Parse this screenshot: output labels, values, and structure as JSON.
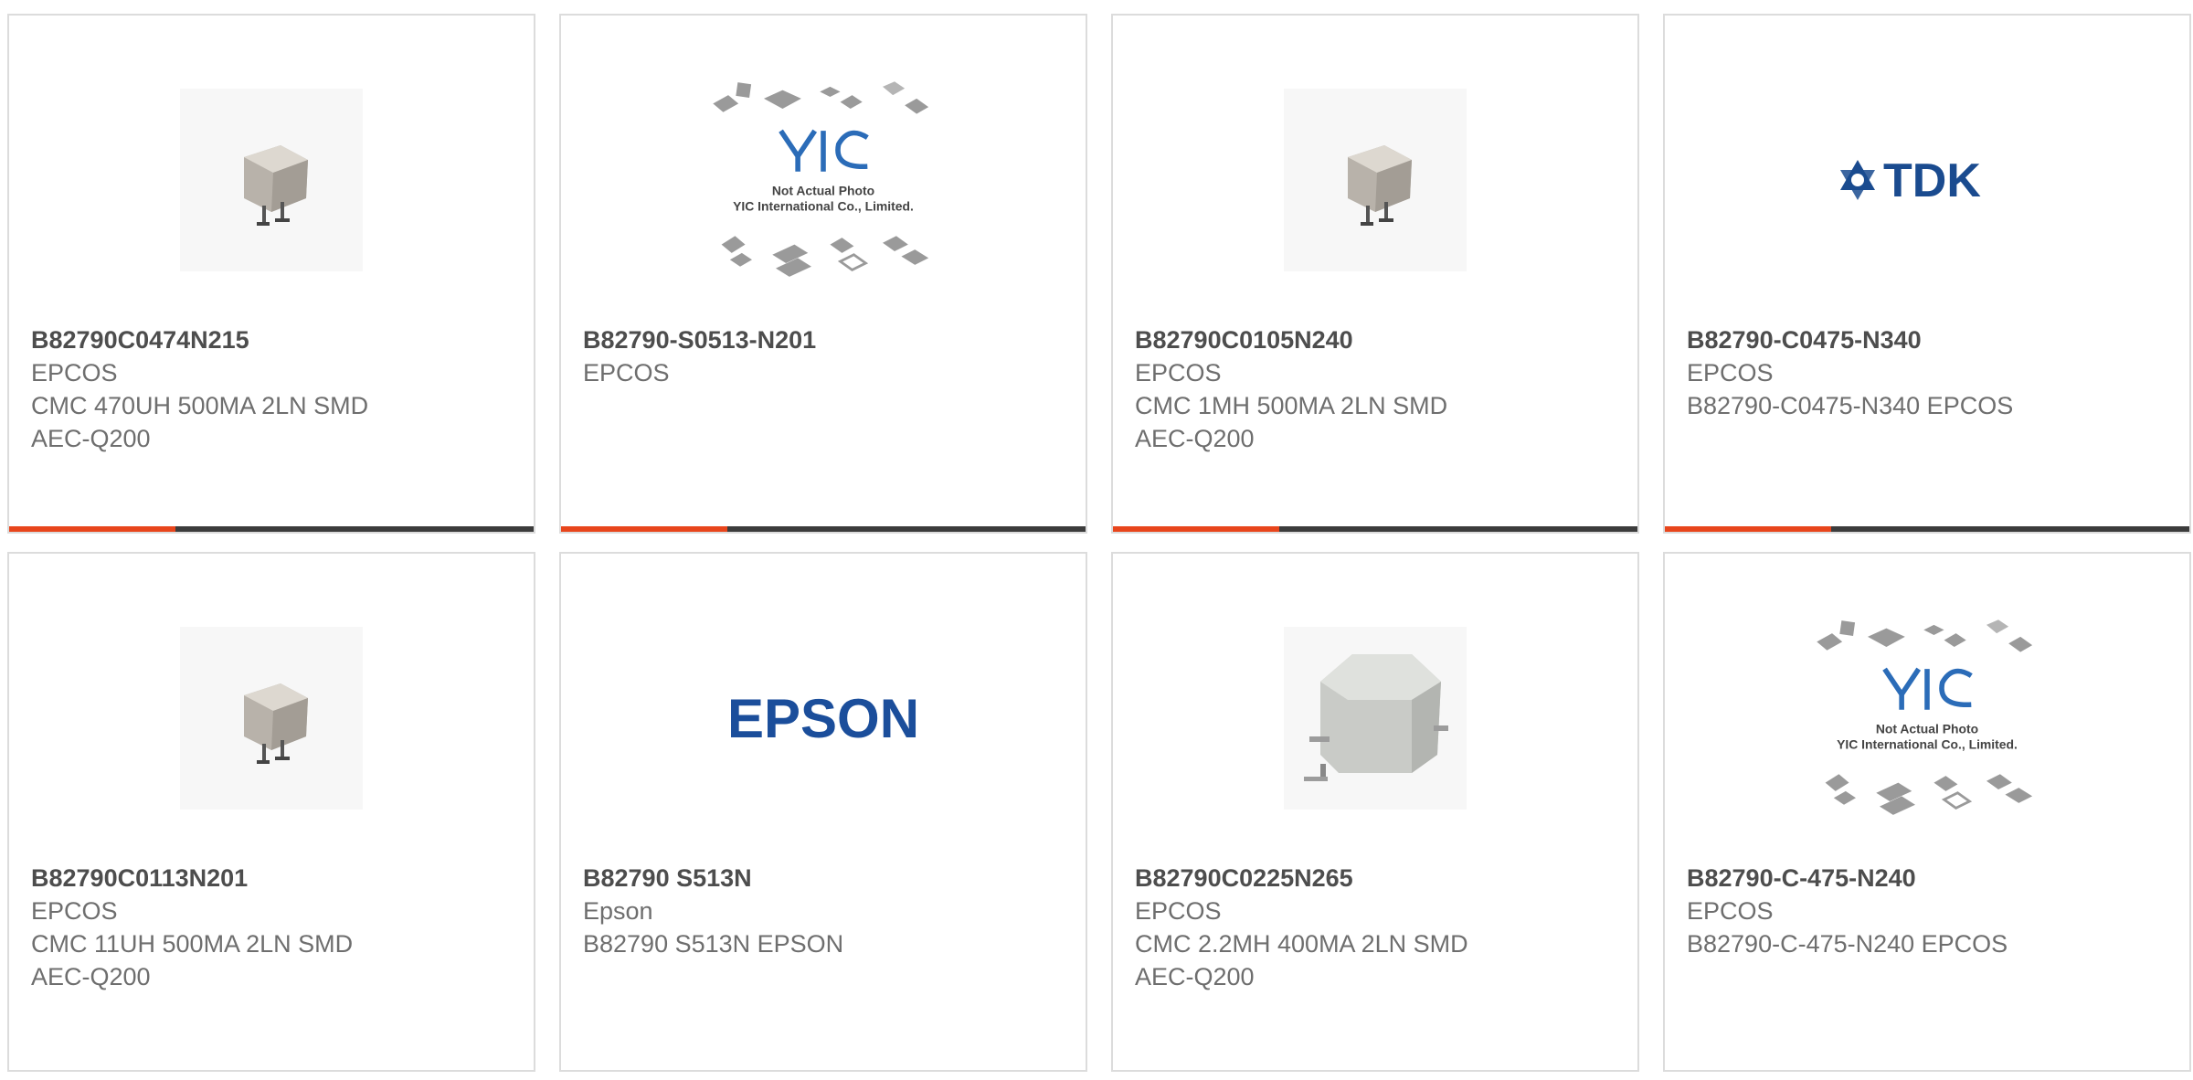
{
  "products": [
    {
      "part_number": "B82790C0474N215",
      "manufacturer": "EPCOS",
      "description": "CMC 470UH 500MA 2LN SMD",
      "description2": "AEC-Q200",
      "image": "inductor-photo-small"
    },
    {
      "part_number": "B82790-S0513-N201",
      "manufacturer": "EPCOS",
      "description": "",
      "description2": "",
      "image": "yic-placeholder"
    },
    {
      "part_number": "B82790C0105N240",
      "manufacturer": "EPCOS",
      "description": "CMC 1MH 500MA 2LN SMD",
      "description2": "AEC-Q200",
      "image": "inductor-photo-small"
    },
    {
      "part_number": "B82790-C0475-N340",
      "manufacturer": "EPCOS",
      "description": "B82790-C0475-N340 EPCOS",
      "description2": "",
      "image": "tdk-logo"
    },
    {
      "part_number": "B82790C0113N201",
      "manufacturer": "EPCOS",
      "description": "CMC 11UH 500MA 2LN SMD",
      "description2": "AEC-Q200",
      "image": "inductor-photo-small"
    },
    {
      "part_number": "B82790 S513N",
      "manufacturer": "Epson",
      "description": "B82790 S513N EPSON",
      "description2": "",
      "image": "epson-logo"
    },
    {
      "part_number": "B82790C0225N265",
      "manufacturer": "EPCOS",
      "description": "CMC 2.2MH 400MA 2LN SMD",
      "description2": "AEC-Q200",
      "image": "inductor-photo-large"
    },
    {
      "part_number": "B82790-C-475-N240",
      "manufacturer": "EPCOS",
      "description": "B82790-C-475-N240 EPCOS",
      "description2": "",
      "image": "yic-placeholder"
    }
  ],
  "placeholder": {
    "line1": "Not Actual Photo",
    "line2": "YIC International Co., Limited."
  },
  "logos": {
    "tdk": "TDK",
    "epson": "EPSON",
    "yic": "YIC"
  },
  "colors": {
    "accent": "#e8451c",
    "bar": "#3c3c3c",
    "tdk_blue": "#1a4b8f",
    "epson_blue": "#1b4e9b",
    "yic_blue": "#2b6cb8"
  }
}
